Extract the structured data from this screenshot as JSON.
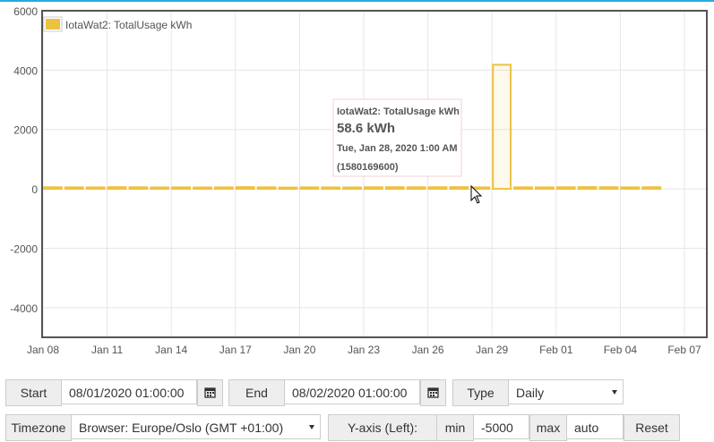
{
  "chart_data": {
    "type": "bar",
    "legend": {
      "label": "IotaWat2: TotalUsage kWh",
      "position": "top-left"
    },
    "series_color": "#edc240",
    "ylim": [
      -5000,
      6000
    ],
    "y_ticks": [
      6000,
      4000,
      2000,
      0,
      -2000,
      -4000
    ],
    "x_ticks": [
      "Jan 08",
      "Jan 11",
      "Jan 14",
      "Jan 17",
      "Jan 20",
      "Jan 23",
      "Jan 26",
      "Jan 29",
      "Feb 01",
      "Feb 04",
      "Feb 07"
    ],
    "grid": true,
    "x_start": "2020-01-08",
    "values": [
      55,
      52,
      50,
      58,
      54,
      48,
      52,
      49,
      51,
      60,
      53,
      45,
      52,
      50,
      48,
      55,
      57,
      54,
      56,
      58.6,
      50,
      4180,
      53,
      50,
      55,
      60,
      57,
      52,
      56
    ]
  },
  "tooltip": {
    "series": "IotaWat2: TotalUsage kWh",
    "value": "58.6 kWh",
    "date": "Tue, Jan 28, 2020 1:00 AM",
    "timestamp": "(1580169600)"
  },
  "controls": {
    "start_label": "Start",
    "start_value": "08/01/2020 01:00:00",
    "end_label": "End",
    "end_value": "08/02/2020 01:00:00",
    "type_label": "Type",
    "type_value": "Daily",
    "timezone_label": "Timezone",
    "timezone_value": "Browser: Europe/Oslo (GMT +01:00)",
    "yaxis_label": "Y-axis (Left):",
    "min_label": "min",
    "min_value": "-5000",
    "max_label": "max",
    "max_value": "auto",
    "reset_label": "Reset"
  },
  "icons": {
    "calendar": "calendar-icon",
    "dropdown": "chevron-down-icon",
    "cursor": "mouse-pointer-icon"
  }
}
